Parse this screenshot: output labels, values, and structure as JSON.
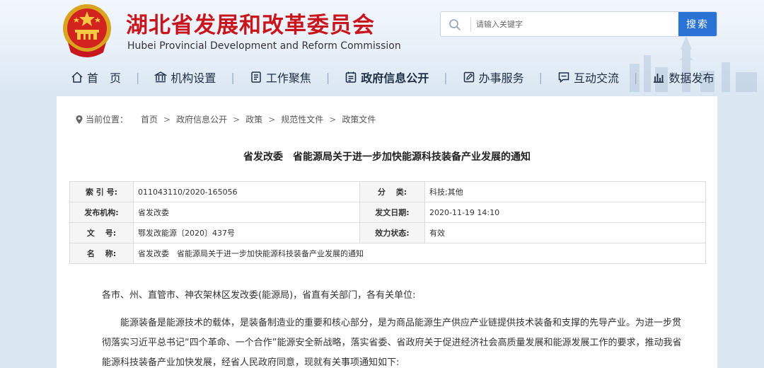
{
  "header": {
    "title": "湖北省发展和改革委员会",
    "subtitle": "Hubei Provincial Development and Reform Commission",
    "search": {
      "placeholder": "请输入关键字",
      "button_label": "搜索"
    }
  },
  "nav": {
    "items": [
      {
        "label": "首　页",
        "icon": "home-icon"
      },
      {
        "label": "机构设置",
        "icon": "institution-icon"
      },
      {
        "label": "工作聚焦",
        "icon": "document-list-icon"
      },
      {
        "label": "政府信息公开",
        "icon": "info-disclosure-icon",
        "active": true
      },
      {
        "label": "办事服务",
        "icon": "service-edit-icon"
      },
      {
        "label": "互动交流",
        "icon": "chat-icon"
      },
      {
        "label": "数据发布",
        "icon": "bar-chart-icon"
      }
    ]
  },
  "breadcrumb": {
    "prefix": "当前位置：",
    "items": [
      "首页",
      "政府信息公开",
      "政策",
      "规范性文件",
      "政策文件"
    ],
    "separator": ">"
  },
  "document": {
    "title": "省发改委　省能源局关于进一步加快能源科技装备产业发展的通知",
    "info": {
      "index_label": "索 引 号:",
      "index_value": "011043110/2020-165056",
      "category_label": "分　 类:",
      "category_value": "科技;其他",
      "issuer_label": "发布机构:",
      "issuer_value": "省发改委",
      "date_label": "发文日期:",
      "date_value": "2020-11-19 14:10",
      "docno_label": "文　 号:",
      "docno_value": "鄂发改能源〔2020〕437号",
      "status_label": "效力状态:",
      "status_value": "有效",
      "name_label": "名　 称:",
      "name_value": "省发改委　省能源局关于进一步加快能源科技装备产业发展的通知"
    },
    "salutation": "各市、州、直管市、神农架林区发改委(能源局)，省直有关部门，各有关单位:",
    "paragraph": "能源装备是能源技术的载体，是装备制造业的重要和核心部分，是为商品能源生产供应产业链提供技术装备和支撑的先导产业。为进一步贯彻落实习近平总书记“四个革命、一个合作”能源安全新战略，落实省委、省政府关于促进经济社会高质量发展和能源发展工作的要求，推动我省能源科技装备产业加快发展，经省人民政府同意，现就有关事项通知如下:"
  },
  "colors": {
    "brand_red": "#c8161e",
    "accent_blue": "#2a73d4",
    "background": "#dbe7f2"
  }
}
